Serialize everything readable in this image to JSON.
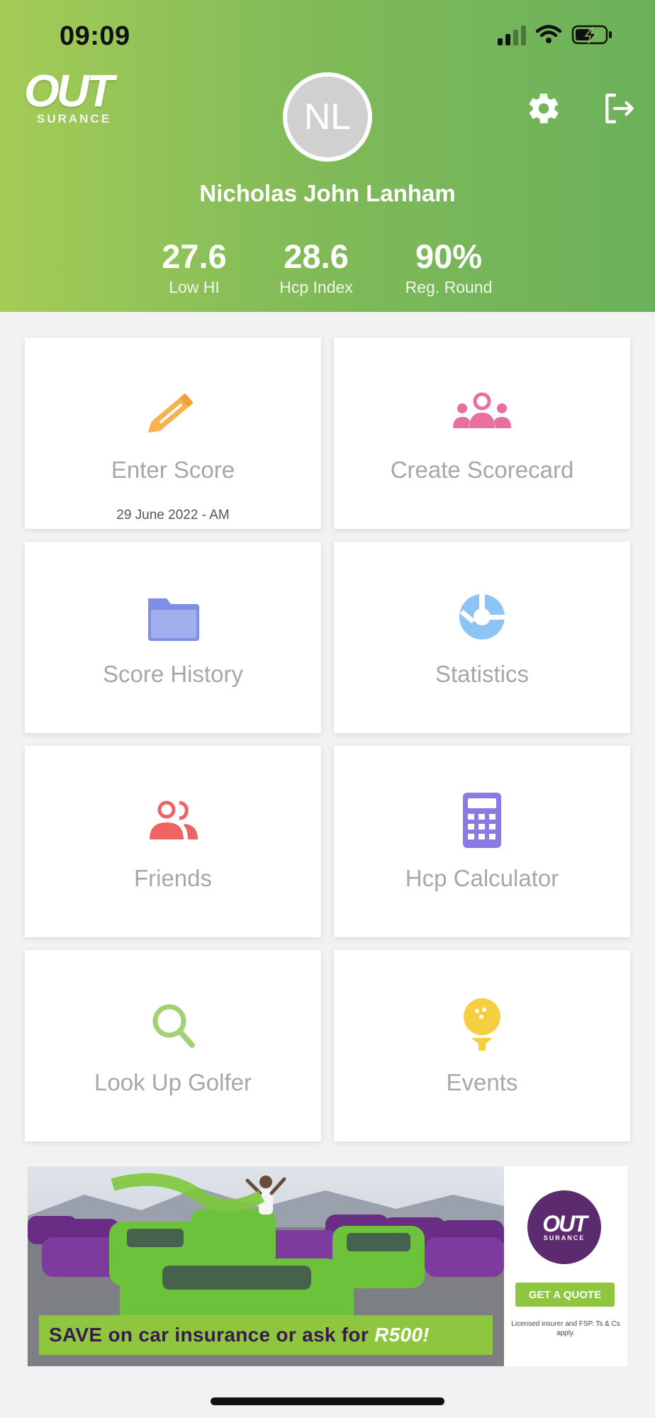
{
  "status_bar": {
    "time": "09:09"
  },
  "header": {
    "logo": {
      "main": "OUT",
      "sub": "SURANCE"
    },
    "avatar_initials": "NL",
    "user_name": "Nicholas John Lanham",
    "stats": [
      {
        "value": "27.6",
        "label": "Low HI"
      },
      {
        "value": "28.6",
        "label": "Hcp Index"
      },
      {
        "value": "90%",
        "label": "Reg. Round"
      }
    ]
  },
  "tiles": [
    {
      "label": "Enter Score",
      "sub": "29 June 2022 - AM",
      "icon": "pencil-icon",
      "color": "#f5b24f"
    },
    {
      "label": "Create Scorecard",
      "sub": "",
      "icon": "group-icon",
      "color": "#e96fa0"
    },
    {
      "label": "Score History",
      "sub": "",
      "icon": "folder-icon",
      "color": "#7f8fe8"
    },
    {
      "label": "Statistics",
      "sub": "",
      "icon": "pie-chart-icon",
      "color": "#8ec3f5"
    },
    {
      "label": "Friends",
      "sub": "",
      "icon": "friends-icon",
      "color": "#ec6464"
    },
    {
      "label": "Hcp Calculator",
      "sub": "",
      "icon": "calculator-icon",
      "color": "#8d79e4"
    },
    {
      "label": "Look Up Golfer",
      "sub": "",
      "icon": "search-icon",
      "color": "#a4d174"
    },
    {
      "label": "Events",
      "sub": "",
      "icon": "golf-ball-tee-icon",
      "color": "#f5cf3f"
    }
  ],
  "ad": {
    "headline_prefix": "SAVE",
    "headline_middle": " on car insurance or ask for ",
    "headline_amount": "R500!",
    "logo_main": "OUT",
    "logo_sub": "SURANCE",
    "button": "GET A QUOTE",
    "legal": "Licensed insurer and FSP. Ts & Cs apply."
  },
  "colors": {
    "header_start": "#a4cc57",
    "header_end": "#6bb15b",
    "brand_purple": "#5c2a6e",
    "brand_green": "#8fc63f"
  }
}
